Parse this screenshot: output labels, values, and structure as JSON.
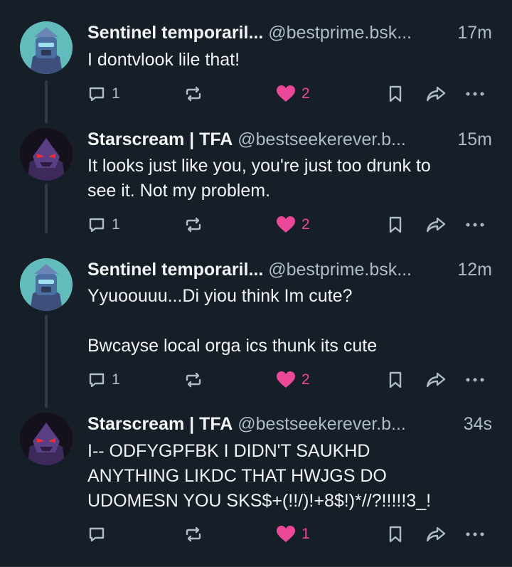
{
  "posts": [
    {
      "name": "Sentinel temporaril...",
      "handle": "@bestprime.bsk...",
      "time": "17m",
      "text": "I dontvlook lile that!",
      "reply_count": "1",
      "like_count": "2",
      "avatar": "sentinel-avatar"
    },
    {
      "name": "Starscream | TFA",
      "handle": "@bestseekerever.b...",
      "time": "15m",
      "text": "It looks just like you, you're just too drunk to\nsee it. Not my problem.",
      "reply_count": "1",
      "like_count": "2",
      "avatar": "starscream-avatar"
    },
    {
      "name": "Sentinel temporaril...",
      "handle": "@bestprime.bsk...",
      "time": "12m",
      "text": "Yyuoouuu...Di yiou think Im cute?\n\nBwcayse local orga ics thunk its cute",
      "reply_count": "1",
      "like_count": "2",
      "avatar": "sentinel-avatar"
    },
    {
      "name": "Starscream | TFA",
      "handle": "@bestseekerever.b...",
      "time": "34s",
      "text": "I-- ODFYGPFBK I DIDN'T SAUKHD\nANYTHING LIKDC THAT HWJGS DO\nUDOMESN YOU SKS$+(!!/)!+8$!)*//?!!!!!3_!",
      "reply_count": "",
      "like_count": "1",
      "avatar": "starscream-avatar"
    }
  ],
  "colors": {
    "background": "#161e27",
    "like": "#ec4899",
    "muted": "#aebbc9",
    "thread_line": "#2e3a48"
  }
}
